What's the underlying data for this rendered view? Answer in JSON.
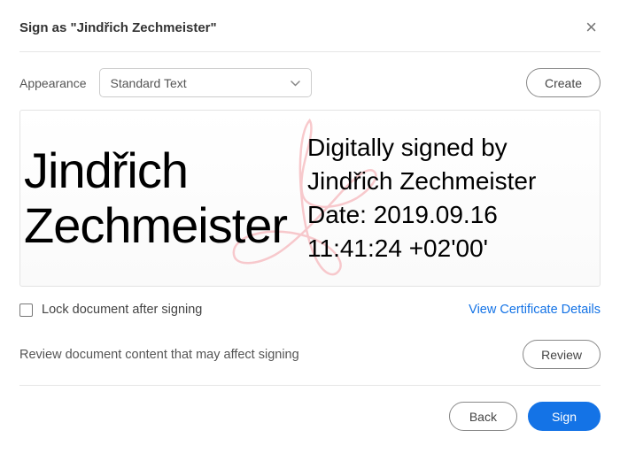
{
  "header": {
    "title": "Sign as \"Jindřich Zechmeister\""
  },
  "appearance": {
    "label": "Appearance",
    "selected": "Standard Text",
    "create_label": "Create"
  },
  "preview": {
    "name_line1": "Jindřich",
    "name_line2": "Zechmeister",
    "detail_line1": "Digitally signed by",
    "detail_line2": "Jindřich Zechmeister",
    "detail_line3": "Date: 2019.09.16",
    "detail_line4": "11:41:24 +02'00'"
  },
  "lock": {
    "label": "Lock document after signing"
  },
  "cert_link": "View Certificate Details",
  "review": {
    "text": "Review document content that may affect signing",
    "button": "Review"
  },
  "footer": {
    "back": "Back",
    "sign": "Sign"
  }
}
